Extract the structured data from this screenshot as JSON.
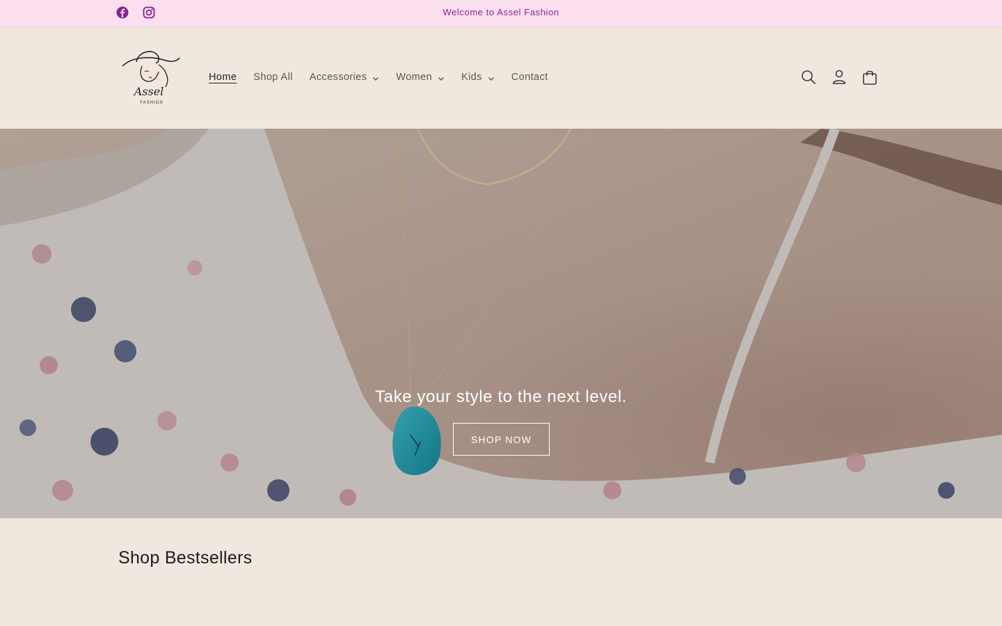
{
  "announcement": {
    "message": "Welcome to Assel Fashion",
    "social": [
      {
        "icon": "facebook-icon"
      },
      {
        "icon": "instagram-icon"
      }
    ]
  },
  "header": {
    "logo": {
      "script": "Assel",
      "sub": "FASHION"
    },
    "nav": [
      {
        "label": "Home",
        "active": true,
        "dropdown": false
      },
      {
        "label": "Shop All",
        "active": false,
        "dropdown": false
      },
      {
        "label": "Accessories",
        "active": false,
        "dropdown": true
      },
      {
        "label": "Women",
        "active": false,
        "dropdown": true
      },
      {
        "label": "Kids",
        "active": false,
        "dropdown": true
      },
      {
        "label": "Contact",
        "active": false,
        "dropdown": false
      }
    ],
    "icons": [
      "search-icon",
      "account-icon",
      "cart-icon"
    ]
  },
  "hero": {
    "headline": "Take your style to the next level.",
    "cta": "SHOP NOW"
  },
  "bestsellers": {
    "heading": "Shop Bestsellers"
  },
  "colors": {
    "announce_bg": "#fde0ef",
    "announce_text": "#8a1f96",
    "page_bg": "#f0e8df",
    "nav_text": "#5b5550"
  }
}
